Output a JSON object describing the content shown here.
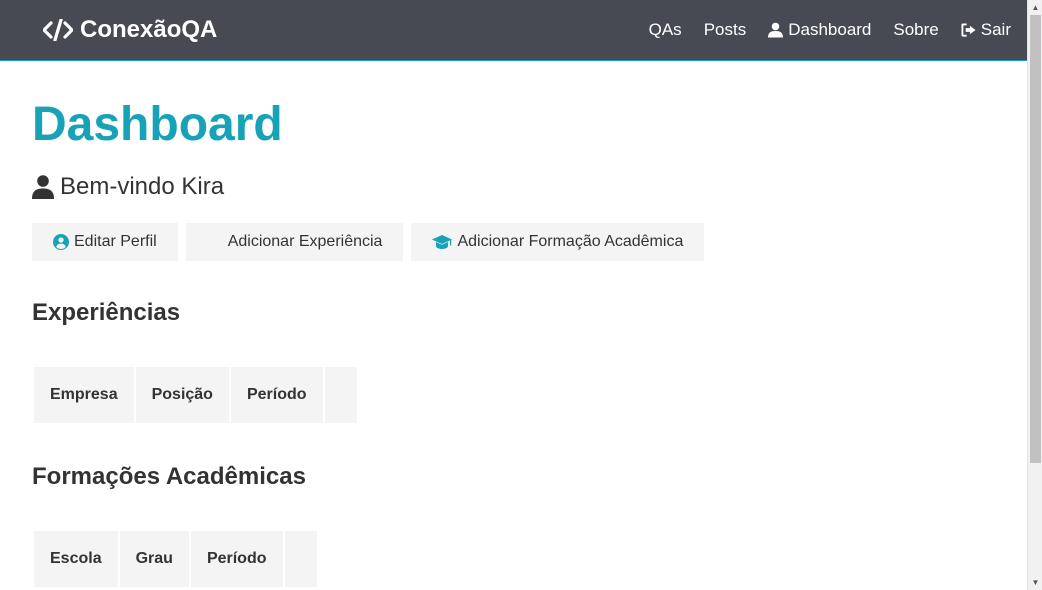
{
  "navbar": {
    "brand": "ConexãoQA",
    "links": {
      "qas": "QAs",
      "posts": "Posts",
      "dashboard": "Dashboard",
      "sobre": "Sobre",
      "sair": "Sair"
    }
  },
  "page": {
    "title": "Dashboard",
    "welcome": "Bem-vindo Kira"
  },
  "actions": {
    "edit_profile": "Editar Perfil",
    "add_experience": "Adicionar Experiência",
    "add_education": "Adicionar Formação Acadêmica"
  },
  "experiences": {
    "title": "Experiências",
    "columns": [
      "Empresa",
      "Posição",
      "Período"
    ]
  },
  "education": {
    "title": "Formações Acadêmicas",
    "columns": [
      "Escola",
      "Grau",
      "Período"
    ]
  },
  "colors": {
    "accent": "#17a2b8",
    "navbar_bg": "#474a52",
    "button_bg": "#f4f4f4"
  }
}
